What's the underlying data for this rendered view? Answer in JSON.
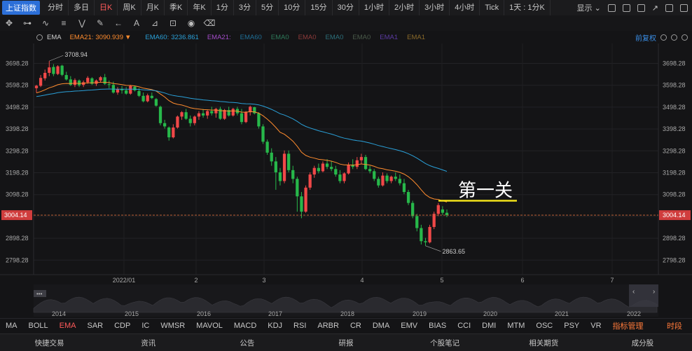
{
  "toolbar": {
    "symbol": "上证指数",
    "timeframes": [
      {
        "label": "分时",
        "active": false
      },
      {
        "label": "多日",
        "active": false
      },
      {
        "label": "日K",
        "active": true
      },
      {
        "label": "周K",
        "active": false
      },
      {
        "label": "月K",
        "active": false
      },
      {
        "label": "季K",
        "active": false
      },
      {
        "label": "年K",
        "active": false
      },
      {
        "label": "1分",
        "active": false
      },
      {
        "label": "3分",
        "active": false
      },
      {
        "label": "5分",
        "active": false
      },
      {
        "label": "10分",
        "active": false
      },
      {
        "label": "15分",
        "active": false
      },
      {
        "label": "30分",
        "active": false
      },
      {
        "label": "1小时",
        "active": false
      },
      {
        "label": "2小时",
        "active": false
      },
      {
        "label": "3小时",
        "active": false
      },
      {
        "label": "4小时",
        "active": false
      },
      {
        "label": "Tick",
        "active": false
      },
      {
        "label": "1天 : 1分K",
        "active": false
      }
    ],
    "display_label": "显示"
  },
  "drawing_tools": [
    "crosshair-icon",
    "line-tool-icon",
    "curve-tool-icon",
    "fib-tool-icon",
    "pattern-tool-icon",
    "pen-tool-icon",
    "arrow-tool-icon",
    "text-tool-icon",
    "measure-tool-icon",
    "lock-icon",
    "eye-icon",
    "trash-icon"
  ],
  "ema_legend": {
    "name": "EMA",
    "items": [
      {
        "label": "EMA21:",
        "value": "3090.939",
        "color": "#ff8c2e",
        "arrow": "▼"
      },
      {
        "label": "EMA60:",
        "value": "3236.861",
        "color": "#2aa0d8",
        "arrow": ""
      },
      {
        "label": "EMA21:",
        "value": "",
        "color": "#a34cc9",
        "arrow": ""
      },
      {
        "label": "EMA60",
        "value": "",
        "color": "#1f6f97",
        "arrow": ""
      },
      {
        "label": "EMA0",
        "value": "",
        "color": "#2e7a5a",
        "arrow": ""
      },
      {
        "label": "EMA0",
        "value": "",
        "color": "#8c3a3a",
        "arrow": ""
      },
      {
        "label": "EMA0",
        "value": "",
        "color": "#2c6f7a",
        "arrow": ""
      },
      {
        "label": "EMA0",
        "value": "",
        "color": "#4a5a4a",
        "arrow": ""
      },
      {
        "label": "EMA1",
        "value": "",
        "color": "#5b3aa3",
        "arrow": ""
      },
      {
        "label": "EMA1",
        "value": "",
        "color": "#8a6a2a",
        "arrow": ""
      }
    ],
    "adjust_label": "前复权"
  },
  "chart_data": {
    "type": "candlestick",
    "y_ticks": [
      3698.28,
      3598.28,
      3498.28,
      3398.28,
      3298.28,
      3198.28,
      3098.28,
      2998.28,
      2898.28,
      2798.28
    ],
    "x_labels": [
      "2022/01",
      "2",
      "3",
      "4",
      "5",
      "6",
      "7"
    ],
    "current_price": "3004.14",
    "high_label": "3708.94",
    "low_label": "2863.65",
    "annotation": "第一关",
    "annotation_level": 3070,
    "candles": [
      {
        "o": 3585,
        "h": 3600,
        "l": 3565,
        "c": 3596
      },
      {
        "o": 3596,
        "h": 3645,
        "l": 3590,
        "c": 3632
      },
      {
        "o": 3630,
        "h": 3670,
        "l": 3620,
        "c": 3655
      },
      {
        "o": 3655,
        "h": 3709,
        "l": 3640,
        "c": 3680
      },
      {
        "o": 3682,
        "h": 3695,
        "l": 3640,
        "c": 3650
      },
      {
        "o": 3650,
        "h": 3690,
        "l": 3645,
        "c": 3685
      },
      {
        "o": 3688,
        "h": 3692,
        "l": 3640,
        "c": 3646
      },
      {
        "o": 3645,
        "h": 3660,
        "l": 3620,
        "c": 3625
      },
      {
        "o": 3625,
        "h": 3640,
        "l": 3595,
        "c": 3600
      },
      {
        "o": 3600,
        "h": 3630,
        "l": 3590,
        "c": 3622
      },
      {
        "o": 3620,
        "h": 3625,
        "l": 3590,
        "c": 3598
      },
      {
        "o": 3600,
        "h": 3620,
        "l": 3590,
        "c": 3612
      },
      {
        "o": 3612,
        "h": 3640,
        "l": 3605,
        "c": 3632
      },
      {
        "o": 3630,
        "h": 3635,
        "l": 3600,
        "c": 3605
      },
      {
        "o": 3605,
        "h": 3625,
        "l": 3595,
        "c": 3620
      },
      {
        "o": 3620,
        "h": 3640,
        "l": 3610,
        "c": 3635
      },
      {
        "o": 3635,
        "h": 3650,
        "l": 3600,
        "c": 3605
      },
      {
        "o": 3603,
        "h": 3620,
        "l": 3585,
        "c": 3600
      },
      {
        "o": 3600,
        "h": 3615,
        "l": 3560,
        "c": 3565
      },
      {
        "o": 3565,
        "h": 3590,
        "l": 3555,
        "c": 3580
      },
      {
        "o": 3580,
        "h": 3595,
        "l": 3560,
        "c": 3575
      },
      {
        "o": 3575,
        "h": 3590,
        "l": 3555,
        "c": 3560
      },
      {
        "o": 3560,
        "h": 3600,
        "l": 3555,
        "c": 3595
      },
      {
        "o": 3592,
        "h": 3595,
        "l": 3570,
        "c": 3575
      },
      {
        "o": 3572,
        "h": 3585,
        "l": 3545,
        "c": 3550
      },
      {
        "o": 3550,
        "h": 3565,
        "l": 3520,
        "c": 3525
      },
      {
        "o": 3525,
        "h": 3560,
        "l": 3520,
        "c": 3552
      },
      {
        "o": 3550,
        "h": 3565,
        "l": 3535,
        "c": 3540
      },
      {
        "o": 3535,
        "h": 3540,
        "l": 3500,
        "c": 3505
      },
      {
        "o": 3500,
        "h": 3505,
        "l": 3415,
        "c": 3425
      },
      {
        "o": 3425,
        "h": 3440,
        "l": 3400,
        "c": 3410
      },
      {
        "o": 3405,
        "h": 3410,
        "l": 3345,
        "c": 3360
      },
      {
        "o": 3360,
        "h": 3420,
        "l": 3355,
        "c": 3405
      },
      {
        "o": 3405,
        "h": 3460,
        "l": 3400,
        "c": 3455
      },
      {
        "o": 3455,
        "h": 3480,
        "l": 3440,
        "c": 3475
      },
      {
        "o": 3475,
        "h": 3490,
        "l": 3440,
        "c": 3445
      },
      {
        "o": 3445,
        "h": 3460,
        "l": 3410,
        "c": 3425
      },
      {
        "o": 3425,
        "h": 3460,
        "l": 3415,
        "c": 3455
      },
      {
        "o": 3455,
        "h": 3480,
        "l": 3440,
        "c": 3470
      },
      {
        "o": 3470,
        "h": 3490,
        "l": 3450,
        "c": 3460
      },
      {
        "o": 3460,
        "h": 3485,
        "l": 3445,
        "c": 3480
      },
      {
        "o": 3480,
        "h": 3500,
        "l": 3460,
        "c": 3470
      },
      {
        "o": 3470,
        "h": 3495,
        "l": 3450,
        "c": 3490
      },
      {
        "o": 3490,
        "h": 3500,
        "l": 3440,
        "c": 3445
      },
      {
        "o": 3445,
        "h": 3490,
        "l": 3440,
        "c": 3485
      },
      {
        "o": 3485,
        "h": 3500,
        "l": 3455,
        "c": 3460
      },
      {
        "o": 3460,
        "h": 3495,
        "l": 3455,
        "c": 3490
      },
      {
        "o": 3490,
        "h": 3500,
        "l": 3460,
        "c": 3470
      },
      {
        "o": 3470,
        "h": 3490,
        "l": 3420,
        "c": 3430
      },
      {
        "o": 3430,
        "h": 3480,
        "l": 3425,
        "c": 3475
      },
      {
        "o": 3475,
        "h": 3505,
        "l": 3460,
        "c": 3500
      },
      {
        "o": 3498,
        "h": 3500,
        "l": 3465,
        "c": 3470
      },
      {
        "o": 3470,
        "h": 3475,
        "l": 3400,
        "c": 3410
      },
      {
        "o": 3410,
        "h": 3420,
        "l": 3330,
        "c": 3340
      },
      {
        "o": 3340,
        "h": 3350,
        "l": 3280,
        "c": 3290
      },
      {
        "o": 3290,
        "h": 3310,
        "l": 3230,
        "c": 3250
      },
      {
        "o": 3250,
        "h": 3270,
        "l": 3120,
        "c": 3200
      },
      {
        "o": 3200,
        "h": 3220,
        "l": 3140,
        "c": 3160
      },
      {
        "o": 3160,
        "h": 3300,
        "l": 3150,
        "c": 3285
      },
      {
        "o": 3285,
        "h": 3300,
        "l": 3200,
        "c": 3210
      },
      {
        "o": 3210,
        "h": 3230,
        "l": 3150,
        "c": 3170
      },
      {
        "o": 3170,
        "h": 3180,
        "l": 3020,
        "c": 3090
      },
      {
        "o": 3090,
        "h": 3110,
        "l": 2990,
        "c": 3020
      },
      {
        "o": 3020,
        "h": 3140,
        "l": 3015,
        "c": 3130
      },
      {
        "o": 3130,
        "h": 3200,
        "l": 3120,
        "c": 3190
      },
      {
        "o": 3190,
        "h": 3230,
        "l": 3175,
        "c": 3220
      },
      {
        "o": 3220,
        "h": 3240,
        "l": 3195,
        "c": 3205
      },
      {
        "o": 3205,
        "h": 3250,
        "l": 3200,
        "c": 3240
      },
      {
        "o": 3240,
        "h": 3260,
        "l": 3215,
        "c": 3225
      },
      {
        "o": 3225,
        "h": 3250,
        "l": 3205,
        "c": 3215
      },
      {
        "o": 3215,
        "h": 3230,
        "l": 3180,
        "c": 3190
      },
      {
        "o": 3190,
        "h": 3210,
        "l": 3150,
        "c": 3160
      },
      {
        "o": 3160,
        "h": 3200,
        "l": 3150,
        "c": 3195
      },
      {
        "o": 3195,
        "h": 3245,
        "l": 3190,
        "c": 3235
      },
      {
        "o": 3235,
        "h": 3260,
        "l": 3215,
        "c": 3225
      },
      {
        "o": 3225,
        "h": 3270,
        "l": 3215,
        "c": 3255
      },
      {
        "o": 3255,
        "h": 3285,
        "l": 3240,
        "c": 3270
      },
      {
        "o": 3270,
        "h": 3280,
        "l": 3210,
        "c": 3215
      },
      {
        "o": 3215,
        "h": 3230,
        "l": 3195,
        "c": 3205
      },
      {
        "o": 3205,
        "h": 3215,
        "l": 3160,
        "c": 3170
      },
      {
        "o": 3170,
        "h": 3180,
        "l": 3130,
        "c": 3140
      },
      {
        "o": 3140,
        "h": 3200,
        "l": 3135,
        "c": 3185
      },
      {
        "o": 3185,
        "h": 3195,
        "l": 3150,
        "c": 3160
      },
      {
        "o": 3160,
        "h": 3185,
        "l": 3150,
        "c": 3180
      },
      {
        "o": 3180,
        "h": 3200,
        "l": 3160,
        "c": 3170
      },
      {
        "o": 3170,
        "h": 3190,
        "l": 3140,
        "c": 3150
      },
      {
        "o": 3150,
        "h": 3170,
        "l": 3100,
        "c": 3110
      },
      {
        "o": 3110,
        "h": 3120,
        "l": 3050,
        "c": 3060
      },
      {
        "o": 3060,
        "h": 3070,
        "l": 2990,
        "c": 3000
      },
      {
        "o": 3000,
        "h": 3010,
        "l": 2930,
        "c": 2945
      },
      {
        "o": 2945,
        "h": 2960,
        "l": 2870,
        "c": 2885
      },
      {
        "o": 2885,
        "h": 2900,
        "l": 2864,
        "c": 2880
      },
      {
        "o": 2880,
        "h": 2960,
        "l": 2875,
        "c": 2950
      },
      {
        "o": 2950,
        "h": 3020,
        "l": 2940,
        "c": 3010
      },
      {
        "o": 3010,
        "h": 3060,
        "l": 3000,
        "c": 3050
      },
      {
        "o": 3030,
        "h": 3045,
        "l": 3005,
        "c": 3015
      },
      {
        "o": 3015,
        "h": 3030,
        "l": 2995,
        "c": 3004
      }
    ]
  },
  "navigator": {
    "years": [
      "2014",
      "2015",
      "2016",
      "2017",
      "2018",
      "2019",
      "2020",
      "2021",
      "2022"
    ],
    "pager_left": "‹",
    "pager_right": "›"
  },
  "indicators": {
    "items": [
      {
        "label": "MA",
        "active": false
      },
      {
        "label": "BOLL",
        "active": false
      },
      {
        "label": "EMA",
        "active": true
      },
      {
        "label": "SAR",
        "active": false
      },
      {
        "label": "CDP",
        "active": false
      },
      {
        "label": "IC",
        "active": false
      },
      {
        "label": "WMSR",
        "active": false
      },
      {
        "label": "MAVOL",
        "active": false
      },
      {
        "label": "MACD",
        "active": false
      },
      {
        "label": "KDJ",
        "active": false
      },
      {
        "label": "RSI",
        "active": false
      },
      {
        "label": "ARBR",
        "active": false
      },
      {
        "label": "CR",
        "active": false
      },
      {
        "label": "DMA",
        "active": false
      },
      {
        "label": "EMV",
        "active": false
      },
      {
        "label": "BIAS",
        "active": false
      },
      {
        "label": "CCI",
        "active": false
      },
      {
        "label": "DMI",
        "active": false
      },
      {
        "label": "MTM",
        "active": false
      },
      {
        "label": "OSC",
        "active": false
      },
      {
        "label": "PSY",
        "active": false
      },
      {
        "label": "VR",
        "active": false
      }
    ],
    "manage_label": "指标管理",
    "timing_label": "时段"
  },
  "bottom_tabs": [
    "快捷交易",
    "资讯",
    "公告",
    "研报",
    "个股笔记",
    "相关期货",
    "成分股"
  ]
}
